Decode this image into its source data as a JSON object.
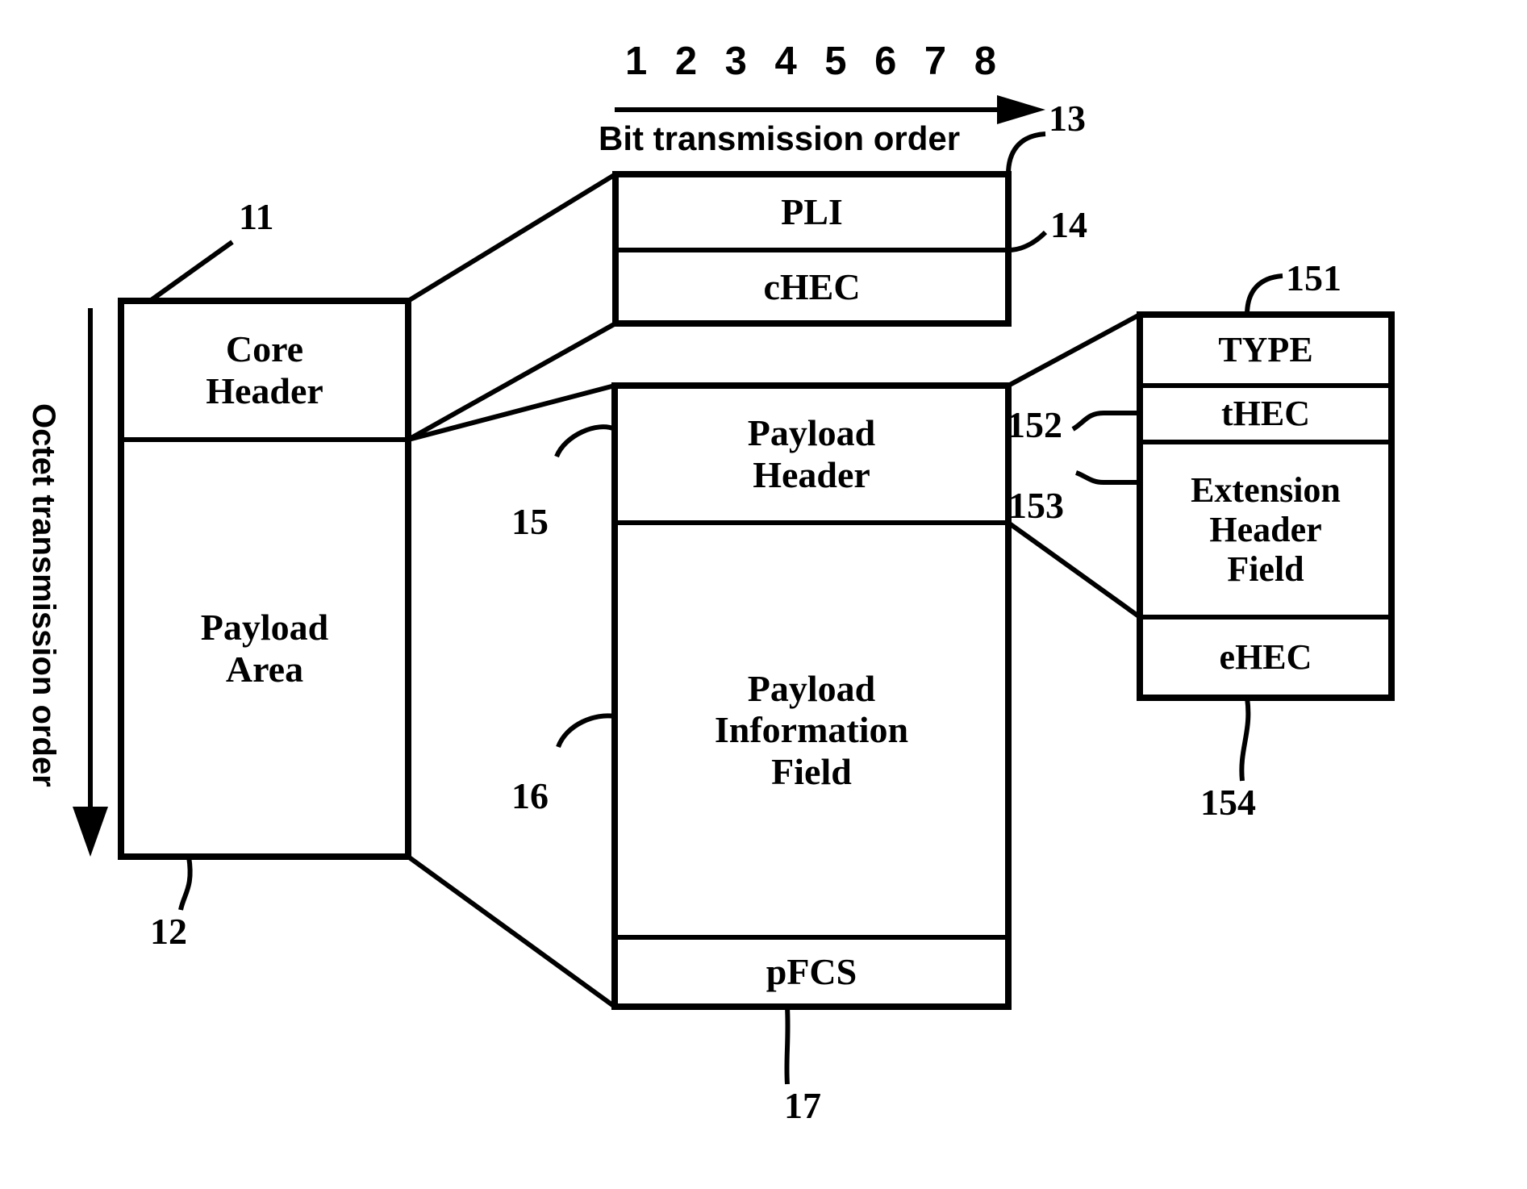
{
  "diagram": {
    "title_bit_order": "Bit transmission order",
    "title_octet_order": "Octet transmission order",
    "bit_numbers": [
      "1",
      "2",
      "3",
      "4",
      "5",
      "6",
      "7",
      "8"
    ],
    "bit_numbers_joined": "1 2 3 4 5 6 7 8"
  },
  "frame": {
    "core_header": "Core\nHeader",
    "core_header_line1": "Core",
    "core_header_line2": "Header",
    "payload_area_line1": "Payload",
    "payload_area_line2": "Area"
  },
  "core_header_detail": {
    "pli": "PLI",
    "chec": "cHEC"
  },
  "payload_area_detail": {
    "payload_header_line1": "Payload",
    "payload_header_line2": "Header",
    "payload_info_line1": "Payload",
    "payload_info_line2": "Information",
    "payload_info_line3": "Field",
    "pfcs": "pFCS"
  },
  "payload_header_detail": {
    "type": "TYPE",
    "thec": "tHEC",
    "ext_line1": "Extension",
    "ext_line2": "Header",
    "ext_line3": "Field",
    "ehec": "eHEC"
  },
  "refs": {
    "r11": "11",
    "r12": "12",
    "r13": "13",
    "r14": "14",
    "r15": "15",
    "r16": "16",
    "r17": "17",
    "r151": "151",
    "r152": "152",
    "r153": "153",
    "r154": "154"
  },
  "colors": {
    "ink": "#000000",
    "paper": "#ffffff"
  }
}
